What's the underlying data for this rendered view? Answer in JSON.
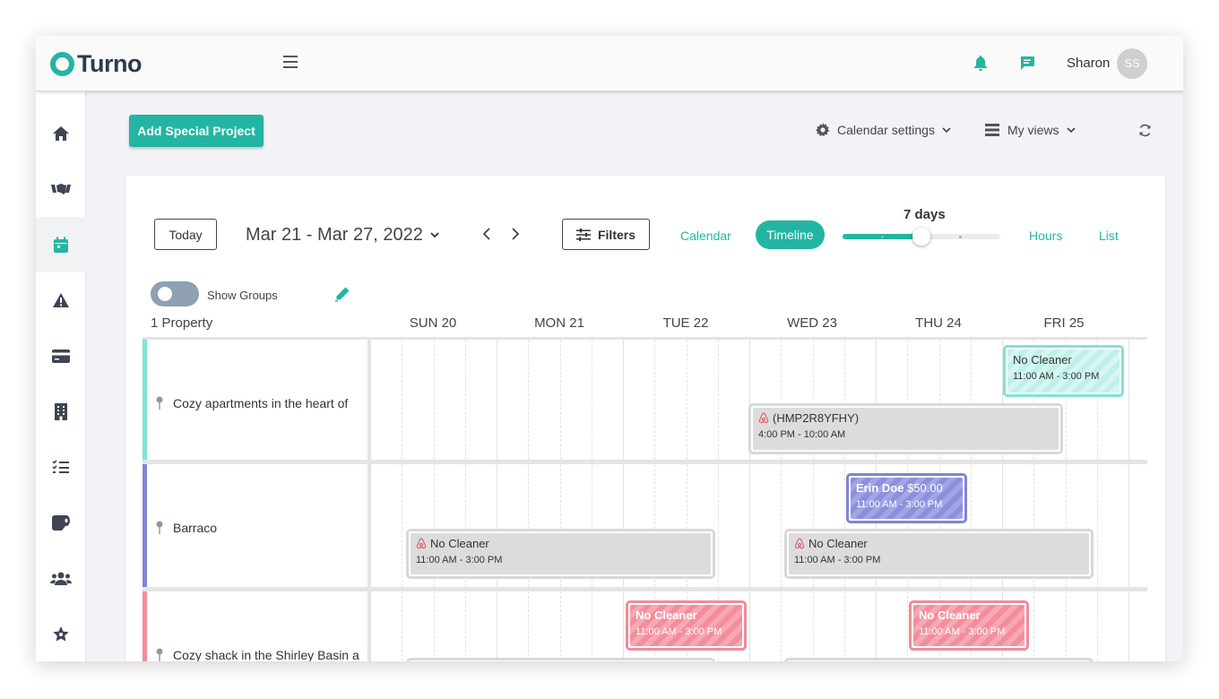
{
  "app": {
    "logo_text": "Turno",
    "brand_color": "#23b5a3"
  },
  "header": {
    "username": "Sharon",
    "avatar_initials": "SS",
    "icons": [
      "hamburger-icon",
      "bell-icon",
      "chat-icon"
    ]
  },
  "sidebar": {
    "items": [
      {
        "icon": "home-icon"
      },
      {
        "icon": "handshake-icon"
      },
      {
        "icon": "calendar-icon",
        "active": true
      },
      {
        "icon": "warning-icon"
      },
      {
        "icon": "credit-card-icon"
      },
      {
        "icon": "building-icon"
      },
      {
        "icon": "checklist-icon"
      },
      {
        "icon": "toilet-paper-icon"
      },
      {
        "icon": "users-icon"
      },
      {
        "icon": "star-icon"
      }
    ]
  },
  "toolbar": {
    "add_special_project": "Add Special Project",
    "calendar_settings": "Calendar settings",
    "my_views": "My views"
  },
  "calendar": {
    "today": "Today",
    "date_range": "Mar 21 - Mar 27, 2022",
    "filters": "Filters",
    "tabs": {
      "calendar": "Calendar",
      "timeline": "Timeline",
      "hours": "Hours",
      "list": "List"
    },
    "days_label": "7 days",
    "days_slider_level": 0.5,
    "show_groups": "Show Groups",
    "property_count": "1 Property",
    "days": [
      "SUN 20",
      "MON 21",
      "TUE 22",
      "WED 23",
      "THU 24",
      "FRI 25"
    ]
  },
  "rows": [
    {
      "name": "Cozy apartments in the heart of",
      "color": "#7ee3d6",
      "events": [
        {
          "title": "No Cleaner",
          "time": "11:00 AM - 3:00 PM",
          "style": "teal"
        },
        {
          "title": "(HMP2R8YFHY)",
          "time": "4:00 PM - 10:00 AM",
          "style": "gray",
          "airbnb": true
        }
      ]
    },
    {
      "name": "Barraco",
      "color": "#8085d6",
      "events": [
        {
          "title_bold": "Erin Doe",
          "title": "$50.00",
          "time": "11:00 AM - 3:00 PM",
          "style": "purple"
        },
        {
          "title": "No Cleaner",
          "time": "11:00 AM - 3:00 PM",
          "style": "gray",
          "airbnb": true
        },
        {
          "title": "No Cleaner",
          "time": "11:00 AM - 3:00 PM",
          "style": "gray",
          "airbnb": true
        }
      ]
    },
    {
      "name": "Cozy shack in the Shirley Basin a",
      "color": "#f28d9b",
      "events": [
        {
          "title": "No Cleaner",
          "time": "11:00 AM - 3:00 PM",
          "style": "pink"
        },
        {
          "title": "No Cleaner",
          "time": "11:00 AM - 3:00 PM",
          "style": "pink"
        }
      ]
    }
  ]
}
